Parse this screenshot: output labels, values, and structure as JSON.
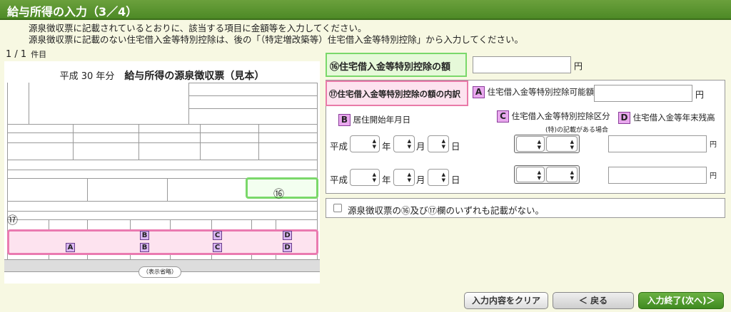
{
  "page": {
    "title": "給与所得の入力（3／4）",
    "intro_line1": "源泉徴収票に記載されているとおりに、該当する項目に金額等を入力してください。",
    "intro_line2": "源泉徴収票に記載のない住宅借入金等特別控除は、後の「（特定増改築等）住宅借入金等特別控除」から入力してください。",
    "count": "1 / 1",
    "count_suffix": "件目"
  },
  "sample": {
    "year": "平成 30 年分",
    "title": "給与所得の源泉徴収票（見本）",
    "marker16": "⑯",
    "marker17": "⑰",
    "omitted": "（表示省略）",
    "badges": [
      "A",
      "B",
      "B",
      "C",
      "C",
      "D",
      "D"
    ]
  },
  "field16": {
    "label": "⑯住宅借入金等特別控除の額",
    "value": "",
    "unit": "円"
  },
  "field17": {
    "label": "⑰住宅借入金等特別控除の額の内訳",
    "a_badge": "A",
    "a_label": "住宅借入金等特別控除可能額",
    "a_value": "",
    "a_unit": "円",
    "b_badge": "B",
    "b_label": "居住開始年月日",
    "c_badge": "C",
    "c_label": "住宅借入金等特別控除区分",
    "c_note": "(特)の記載がある場合",
    "d_badge": "D",
    "d_label": "住宅借入金等年末残高",
    "era": "平成",
    "year_unit": "年",
    "month_unit": "月",
    "day_unit": "日",
    "yen": "円",
    "rows": [
      {
        "d_value": ""
      },
      {
        "d_value": ""
      }
    ]
  },
  "checkbox": {
    "label": "源泉徴収票の⑯及び⑰欄のいずれも記載がない。",
    "checked": false
  },
  "buttons": {
    "clear": "入力内容をクリア",
    "back": "＜ 戻る",
    "next": "入力終了(次へ)＞"
  }
}
